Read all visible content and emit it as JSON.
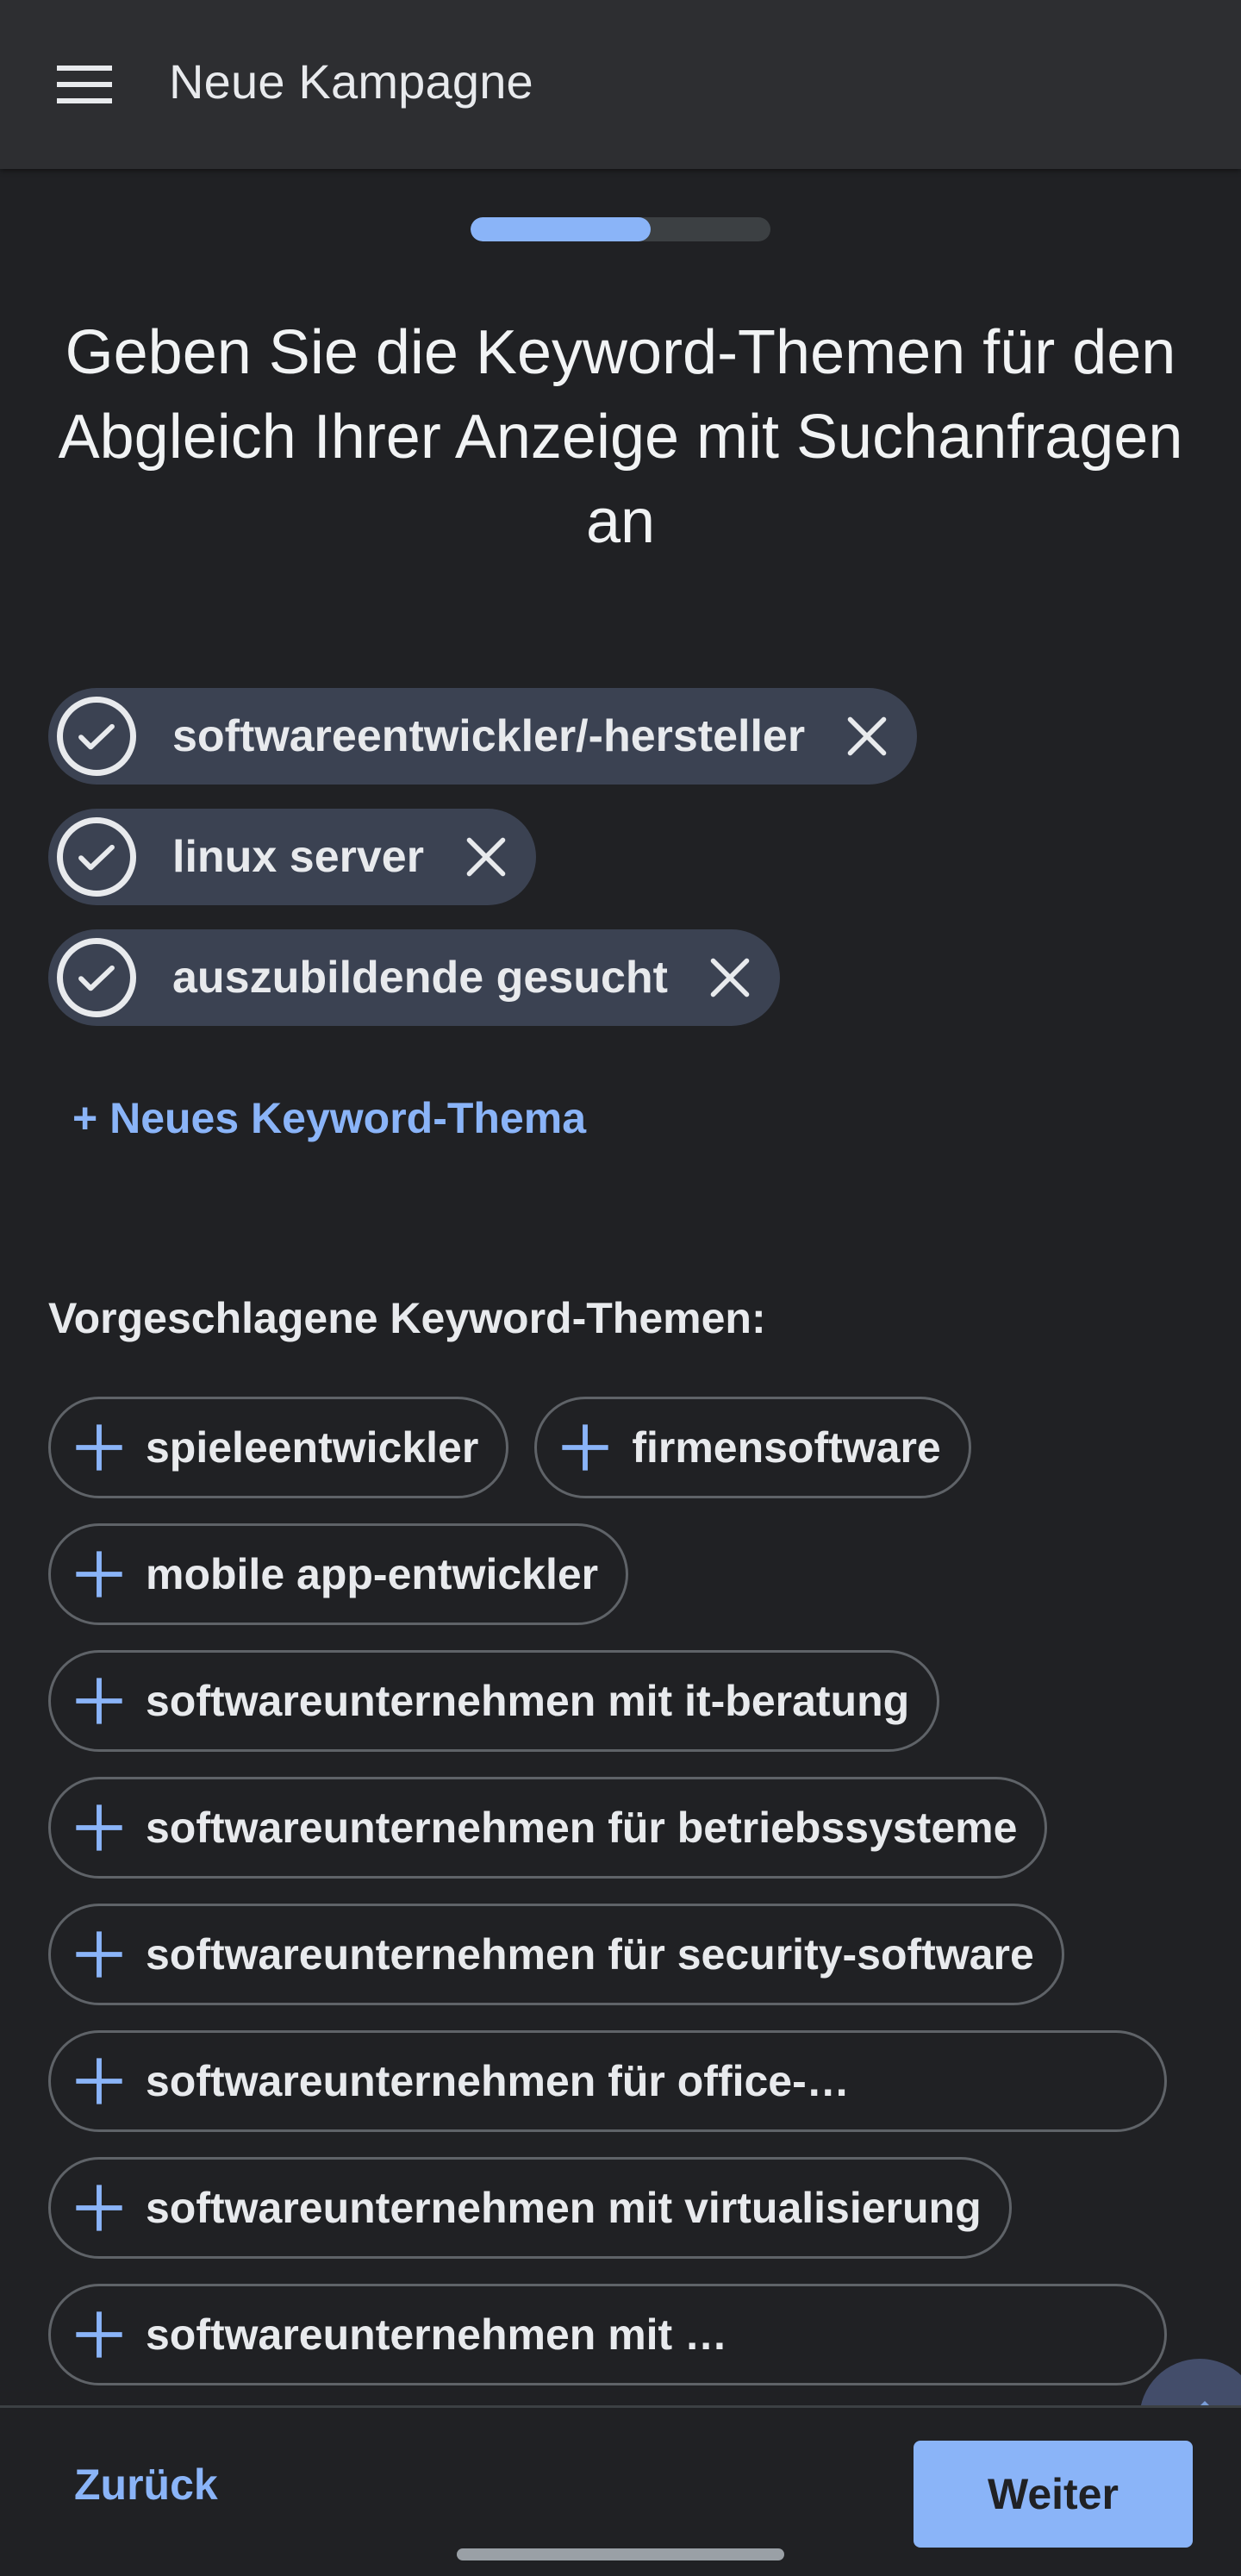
{
  "header": {
    "title": "Neue Kampagne",
    "menu_icon": "hamburger-menu-icon"
  },
  "progress": {
    "value": 0.6
  },
  "headline": "Geben Sie die Keyword-Themen für den Abgleich Ihrer Anzeige mit Suchanfragen an",
  "selected_keywords": [
    {
      "label": "softwareentwickler/-hersteller"
    },
    {
      "label": "linux server"
    },
    {
      "label": "auszubildende gesucht"
    }
  ],
  "add_keyword_label": "+ Neues Keyword-Thema",
  "suggestions_heading": "Vorgeschlagene Keyword-Themen:",
  "suggestions": [
    {
      "label": "spieleentwickler"
    },
    {
      "label": "firmensoftware"
    },
    {
      "label": "mobile app-entwickler"
    },
    {
      "label": "softwareunternehmen mit it-beratung"
    },
    {
      "label": "softwareunternehmen für betriebssysteme"
    },
    {
      "label": "softwareunternehmen für security-software"
    },
    {
      "label": "softwareunternehmen für office-…"
    },
    {
      "label": "softwareunternehmen mit virtualisierung"
    },
    {
      "label": "softwareunternehmen mit …"
    }
  ],
  "footer": {
    "back_label": "Zurück",
    "next_label": "Weiter"
  },
  "colors": {
    "accent": "#8ab4f8",
    "background": "#202124",
    "chip_selected": "#3b4252"
  }
}
